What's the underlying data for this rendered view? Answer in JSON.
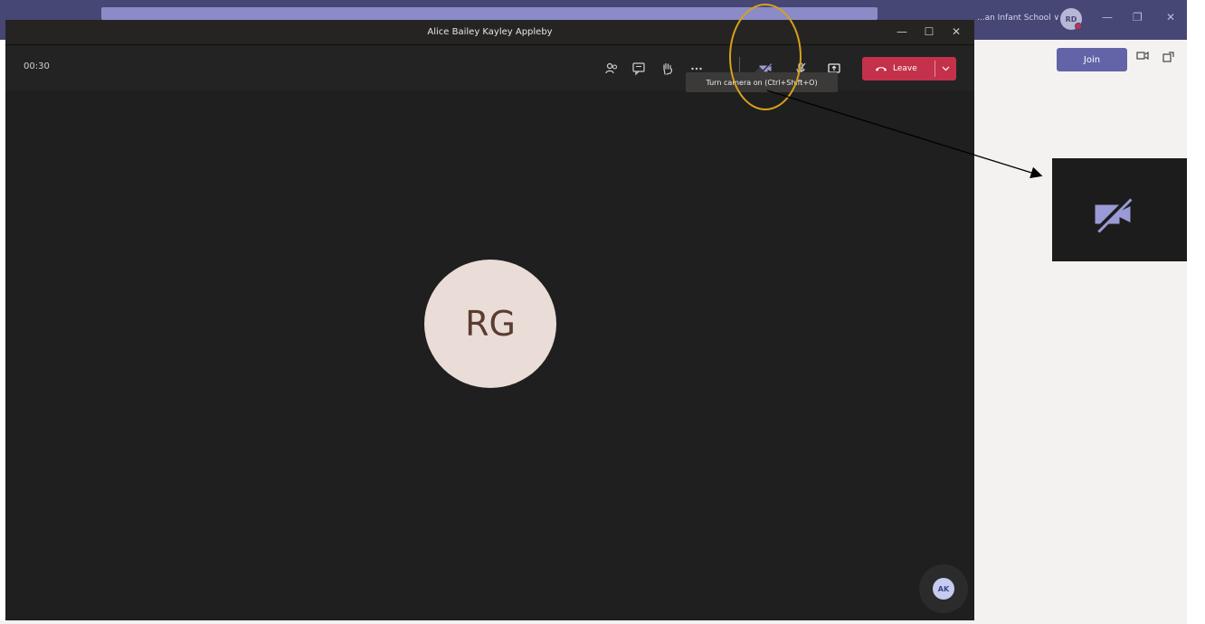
{
  "background_app": {
    "org_label": "...an Infant School ∨",
    "avatar_initials": "RD",
    "window_controls": [
      "—",
      "❐",
      "✕"
    ],
    "join_label": "Join"
  },
  "meeting": {
    "title": "Alice Bailey Kayley Appleby",
    "timer": "00:30",
    "window_controls": [
      "—",
      "☐",
      "✕"
    ],
    "toolbar": {
      "leave_label": "Leave"
    },
    "tooltip": "Turn camera on (Ctrl+Shift+O)",
    "participant_initials": "RG",
    "self_initials": "AK"
  },
  "colors": {
    "meeting_bg": "#1f1f1f",
    "leave_red": "#c4314b",
    "teams_purple": "#6264a7",
    "camera_icon": "#9a9ad6",
    "highlight": "#d9a01a"
  },
  "icons": {
    "toolbar": [
      "people-icon",
      "chat-icon",
      "raise-hand-icon",
      "more-icon",
      "camera-off-icon",
      "mic-off-icon",
      "share-screen-icon",
      "phone-hangup-icon",
      "chevron-down-icon"
    ]
  }
}
